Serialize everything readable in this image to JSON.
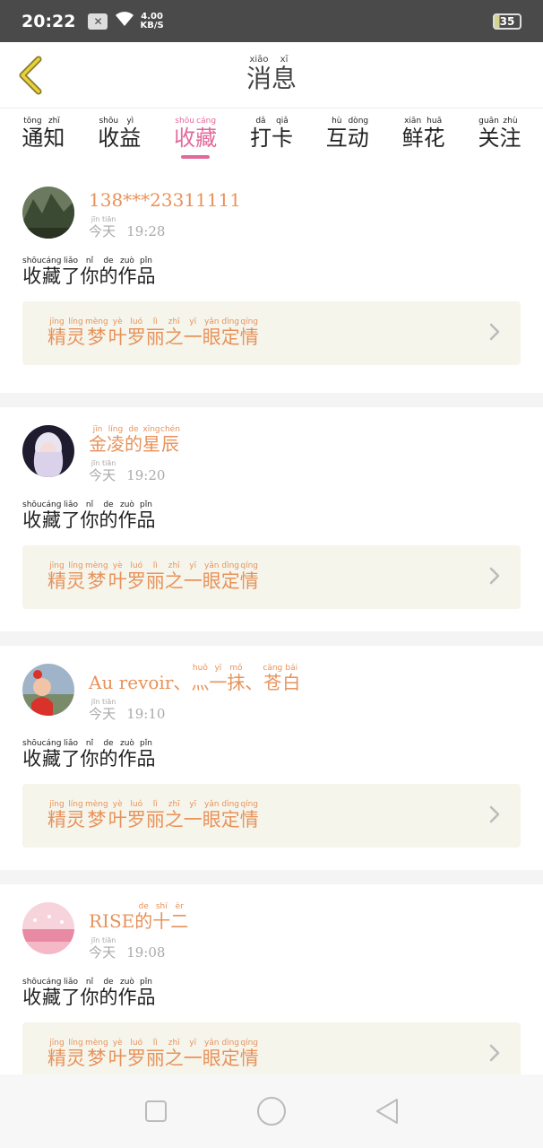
{
  "status_bar": {
    "time": "20:22",
    "notif_icon": "x-icon",
    "speed": "4.00",
    "speed_unit": "KB/S",
    "battery": "35"
  },
  "header": {
    "title_chars": [
      {
        "c": "消",
        "p": "xiāo"
      },
      {
        "c": "息",
        "p": "xī"
      }
    ]
  },
  "tabs": [
    {
      "chars": [
        {
          "c": "通",
          "p": "tōng"
        },
        {
          "c": "知",
          "p": "zhī"
        }
      ],
      "active": false
    },
    {
      "chars": [
        {
          "c": "收",
          "p": "shōu"
        },
        {
          "c": "益",
          "p": "yì"
        }
      ],
      "active": false
    },
    {
      "chars": [
        {
          "c": "收",
          "p": "shōu"
        },
        {
          "c": "藏",
          "p": "cáng"
        }
      ],
      "active": true
    },
    {
      "chars": [
        {
          "c": "打",
          "p": "dǎ"
        },
        {
          "c": "卡",
          "p": "qiǎ"
        }
      ],
      "active": false
    },
    {
      "chars": [
        {
          "c": "互",
          "p": "hù"
        },
        {
          "c": "动",
          "p": "dòng"
        }
      ],
      "active": false
    },
    {
      "chars": [
        {
          "c": "鲜",
          "p": "xiān"
        },
        {
          "c": "花",
          "p": "huā"
        }
      ],
      "active": false
    },
    {
      "chars": [
        {
          "c": "关",
          "p": "guān"
        },
        {
          "c": "注",
          "p": "zhù"
        }
      ],
      "active": false
    }
  ],
  "action_chars": [
    {
      "c": "收",
      "p": "shōu"
    },
    {
      "c": "藏",
      "p": "cáng"
    },
    {
      "c": "了",
      "p": "liǎo"
    },
    {
      "c": "你",
      "p": "nǐ"
    },
    {
      "c": "的",
      "p": "de"
    },
    {
      "c": "作",
      "p": "zuò"
    },
    {
      "c": "品",
      "p": "pǐn"
    }
  ],
  "work_chars": [
    {
      "c": "精",
      "p": "jīng"
    },
    {
      "c": "灵",
      "p": "líng"
    },
    {
      "c": "梦",
      "p": "mèng"
    },
    {
      "c": "叶",
      "p": "yè"
    },
    {
      "c": "罗",
      "p": "luó"
    },
    {
      "c": "丽",
      "p": "lì"
    },
    {
      "c": "之",
      "p": "zhī"
    },
    {
      "c": "一",
      "p": "yī"
    },
    {
      "c": "眼",
      "p": "yǎn"
    },
    {
      "c": "定",
      "p": "dìng"
    },
    {
      "c": "情",
      "p": "qíng"
    }
  ],
  "today_chars": [
    {
      "c": "今",
      "p": "jīn"
    },
    {
      "c": "天",
      "p": "tiān"
    }
  ],
  "items": [
    {
      "user_plain": "138***23311111",
      "user_chars": [],
      "time": "19:28",
      "avatar": "mountain"
    },
    {
      "user_plain": "",
      "user_chars": [
        {
          "c": "金",
          "p": "jīn"
        },
        {
          "c": "凌",
          "p": "líng"
        },
        {
          "c": "的",
          "p": "de"
        },
        {
          "c": "星",
          "p": "xīng"
        },
        {
          "c": "辰",
          "p": "chén"
        }
      ],
      "time": "19:20",
      "avatar": "anime"
    },
    {
      "user_plain": "Au revoir、",
      "user_chars": [
        {
          "c": "灬",
          "p": "huǒ"
        },
        {
          "c": "一",
          "p": "yī"
        },
        {
          "c": "抹",
          "p": "mǒ"
        },
        {
          "c": "、",
          "p": ""
        },
        {
          "c": "苍",
          "p": "cāng"
        },
        {
          "c": "白",
          "p": "bái"
        }
      ],
      "time": "19:10",
      "avatar": "girl"
    },
    {
      "user_plain": "RISE",
      "user_chars": [
        {
          "c": "的",
          "p": "de"
        },
        {
          "c": "十",
          "p": "shí"
        },
        {
          "c": "二",
          "p": "èr"
        }
      ],
      "time": "19:08",
      "avatar": "pink"
    }
  ],
  "navbar": {
    "recent_icon": "square-icon",
    "home_icon": "circle-icon",
    "back_icon": "triangle-back-icon"
  },
  "colors": {
    "accent": "#e26a9a",
    "name_orange": "#e8925a",
    "card_bg": "#f5f5ec"
  }
}
